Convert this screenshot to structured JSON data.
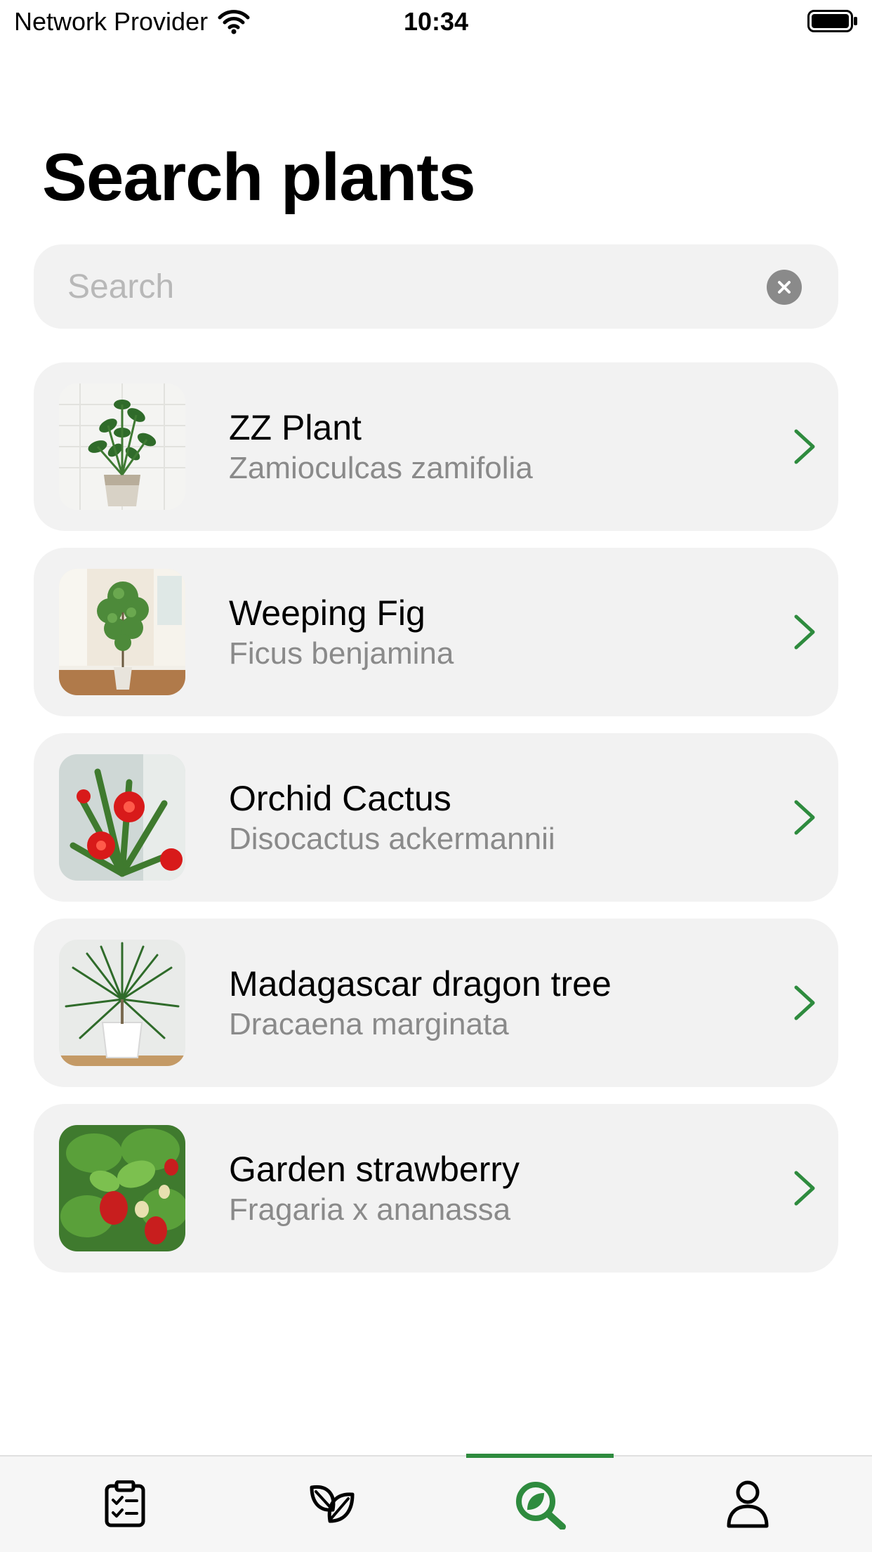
{
  "status_bar": {
    "provider": "Network Provider",
    "time": "10:34"
  },
  "page": {
    "title": "Search plants"
  },
  "search": {
    "placeholder": "Search",
    "value": ""
  },
  "plants": [
    {
      "name": "ZZ Plant",
      "scientific": "Zamioculcas zamifolia"
    },
    {
      "name": "Weeping Fig",
      "scientific": "Ficus benjamina"
    },
    {
      "name": "Orchid Cactus",
      "scientific": "Disocactus ackermannii"
    },
    {
      "name": "Madagascar dragon tree",
      "scientific": "Dracaena marginata"
    },
    {
      "name": "Garden strawberry",
      "scientific": "Fragaria x ananassa"
    }
  ],
  "tabs": [
    {
      "icon": "checklist-icon",
      "active": false
    },
    {
      "icon": "leaves-icon",
      "active": false
    },
    {
      "icon": "plant-search-icon",
      "active": true
    },
    {
      "icon": "person-icon",
      "active": false
    }
  ],
  "colors": {
    "accent": "#2e8b3e",
    "card": "#f2f2f2",
    "secondary_text": "#8a8a8a"
  }
}
